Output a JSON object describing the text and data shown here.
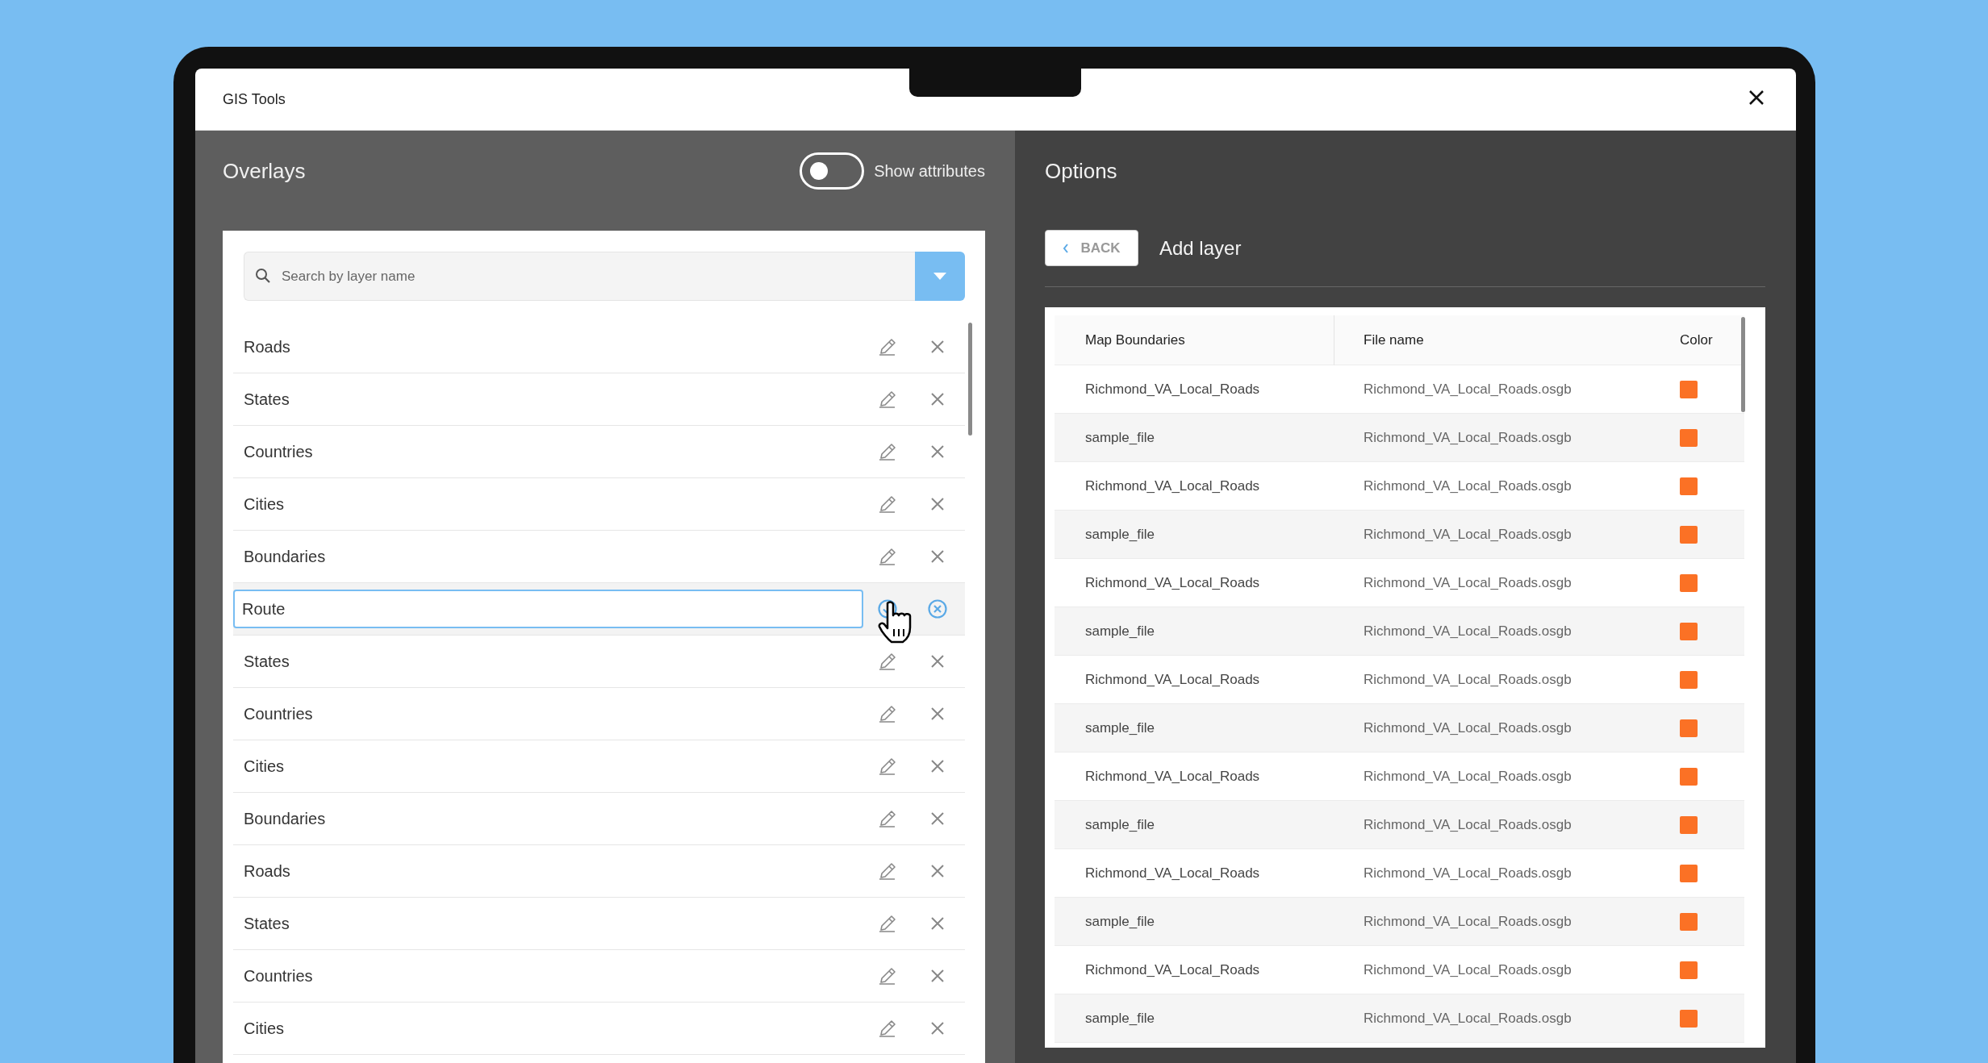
{
  "window": {
    "title": "GIS Tools"
  },
  "overlays": {
    "title": "Overlays",
    "toggle": {
      "label": "Show attributes",
      "on": false
    },
    "search": {
      "placeholder": "Search by layer name"
    },
    "layers": [
      {
        "name": "Roads",
        "editing": false
      },
      {
        "name": "States",
        "editing": false
      },
      {
        "name": "Countries",
        "editing": false
      },
      {
        "name": "Cities",
        "editing": false
      },
      {
        "name": "Boundaries",
        "editing": false
      },
      {
        "name": "Route",
        "editing": true
      },
      {
        "name": "States",
        "editing": false
      },
      {
        "name": "Countries",
        "editing": false
      },
      {
        "name": "Cities",
        "editing": false
      },
      {
        "name": "Boundaries",
        "editing": false
      },
      {
        "name": "Roads",
        "editing": false
      },
      {
        "name": "States",
        "editing": false
      },
      {
        "name": "Countries",
        "editing": false
      },
      {
        "name": "Cities",
        "editing": false
      }
    ]
  },
  "options": {
    "title": "Options",
    "back_button": "BACK",
    "subtitle": "Add layer",
    "table": {
      "columns": [
        "Map Boundaries",
        "File name",
        "Color"
      ],
      "rows": [
        {
          "map": "Richmond_VA_Local_Roads",
          "file": "Richmond_VA_Local_Roads.osgb",
          "color": "#fb7125"
        },
        {
          "map": "sample_file",
          "file": "Richmond_VA_Local_Roads.osgb",
          "color": "#fb7125"
        },
        {
          "map": "Richmond_VA_Local_Roads",
          "file": "Richmond_VA_Local_Roads.osgb",
          "color": "#fb7125"
        },
        {
          "map": "sample_file",
          "file": "Richmond_VA_Local_Roads.osgb",
          "color": "#fb7125"
        },
        {
          "map": "Richmond_VA_Local_Roads",
          "file": "Richmond_VA_Local_Roads.osgb",
          "color": "#fb7125"
        },
        {
          "map": "sample_file",
          "file": "Richmond_VA_Local_Roads.osgb",
          "color": "#fb7125"
        },
        {
          "map": "Richmond_VA_Local_Roads",
          "file": "Richmond_VA_Local_Roads.osgb",
          "color": "#fb7125"
        },
        {
          "map": "sample_file",
          "file": "Richmond_VA_Local_Roads.osgb",
          "color": "#fb7125"
        },
        {
          "map": "Richmond_VA_Local_Roads",
          "file": "Richmond_VA_Local_Roads.osgb",
          "color": "#fb7125"
        },
        {
          "map": "sample_file",
          "file": "Richmond_VA_Local_Roads.osgb",
          "color": "#fb7125"
        },
        {
          "map": "Richmond_VA_Local_Roads",
          "file": "Richmond_VA_Local_Roads.osgb",
          "color": "#fb7125"
        },
        {
          "map": "sample_file",
          "file": "Richmond_VA_Local_Roads.osgb",
          "color": "#fb7125"
        },
        {
          "map": "Richmond_VA_Local_Roads",
          "file": "Richmond_VA_Local_Roads.osgb",
          "color": "#fb7125"
        },
        {
          "map": "sample_file",
          "file": "Richmond_VA_Local_Roads.osgb",
          "color": "#fb7125"
        }
      ]
    }
  }
}
